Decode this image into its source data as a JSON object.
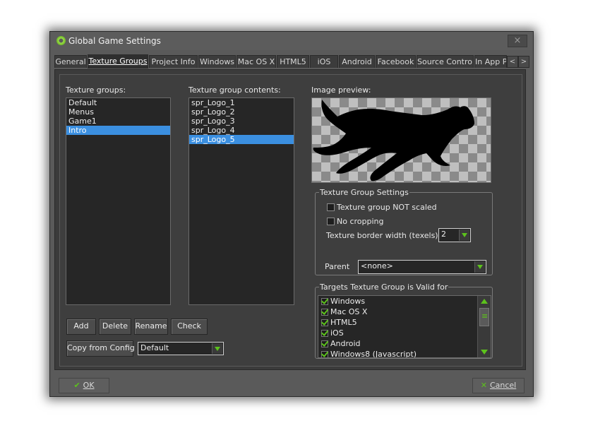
{
  "window": {
    "title": "Global Game Settings",
    "close_label": "×"
  },
  "tabs": [
    {
      "label": "General"
    },
    {
      "label": "Texture Groups",
      "active": true
    },
    {
      "label": "Project Info"
    },
    {
      "label": "Windows"
    },
    {
      "label": "Mac OS X"
    },
    {
      "label": "HTML5"
    },
    {
      "label": "iOS"
    },
    {
      "label": "Android"
    },
    {
      "label": "Facebook"
    },
    {
      "label": "Source Control"
    },
    {
      "label": "In App Pu"
    }
  ],
  "tab_scroll": {
    "left": "<",
    "right": ">"
  },
  "texture_groups": {
    "label": "Texture groups:",
    "items": [
      "Default",
      "Menus",
      "Game1",
      "Intro"
    ],
    "selected": "Intro"
  },
  "group_contents": {
    "label": "Texture group contents:",
    "items": [
      "spr_Logo_1",
      "spr_Logo_2",
      "spr_Logo_3",
      "spr_Logo_4",
      "spr_Logo_5"
    ],
    "selected": "spr_Logo_5"
  },
  "preview": {
    "label": "Image preview:"
  },
  "settings": {
    "title": "Texture Group Settings",
    "not_scaled_label": "Texture group NOT scaled",
    "not_scaled_checked": false,
    "no_cropping_label": "No cropping",
    "no_cropping_checked": false,
    "border_width_label": "Texture border width (texels):",
    "border_width_value": "2",
    "parent_label": "Parent",
    "parent_value": "<none>"
  },
  "targets": {
    "title": "Targets Texture Group is Valid for",
    "items": [
      "Windows",
      "Mac OS X",
      "HTML5",
      "iOS",
      "Android",
      "Windows8 (Javascript)"
    ]
  },
  "buttons": {
    "add": "Add",
    "delete": "Delete",
    "rename": "Rename",
    "check": "Check",
    "copy_from_config": "Copy from Config"
  },
  "config_combo": {
    "value": "Default"
  },
  "footer": {
    "ok": "OK",
    "cancel": "Cancel"
  },
  "colors": {
    "accent_green": "#5cc21c",
    "selection_blue": "#3b8fe0"
  }
}
